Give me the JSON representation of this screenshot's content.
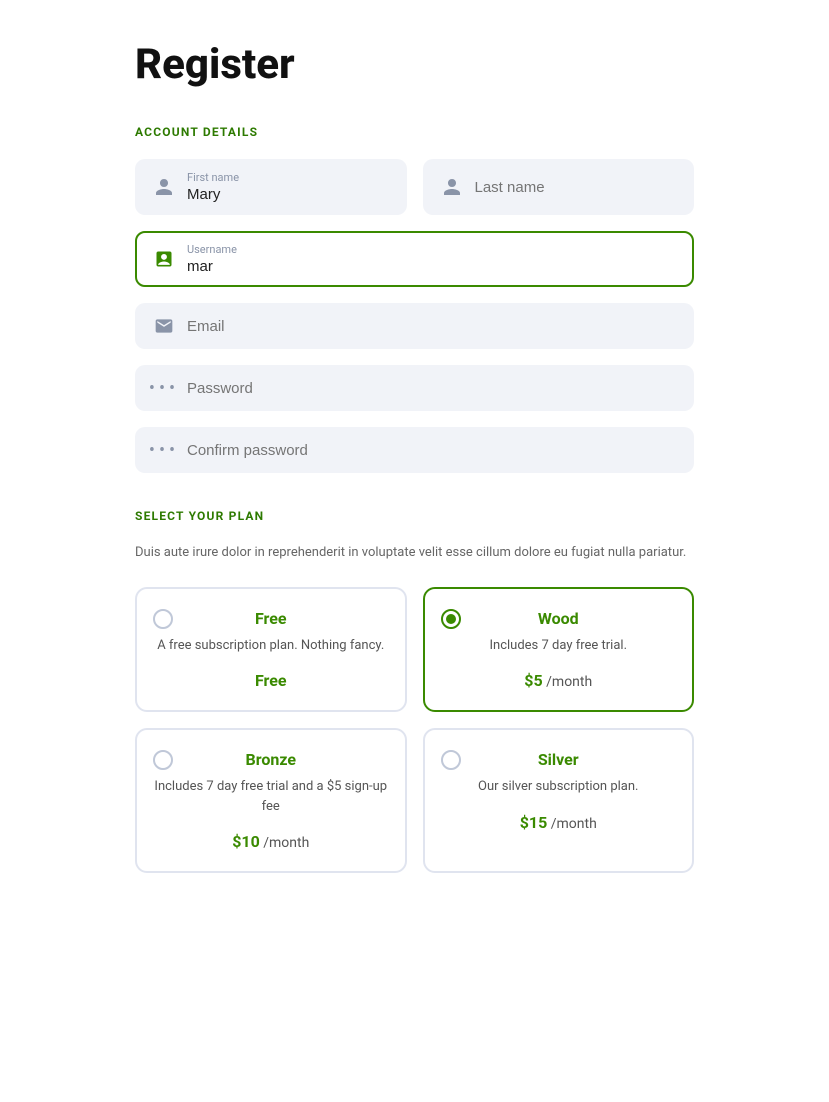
{
  "page": {
    "title": "Register"
  },
  "account_section": {
    "label": "ACCOUNT DETAILS",
    "first_name": {
      "label": "First name",
      "value": "Mary",
      "placeholder": ""
    },
    "last_name": {
      "label": "Last name",
      "value": "",
      "placeholder": "Last name"
    },
    "username": {
      "label": "Username",
      "value": "mar",
      "placeholder": ""
    },
    "email": {
      "label": "Email",
      "placeholder": "Email"
    },
    "password": {
      "label": "Password",
      "placeholder": "Password"
    },
    "confirm_password": {
      "label": "Confirm password",
      "placeholder": "Confirm password"
    }
  },
  "plan_section": {
    "label": "SELECT YOUR PLAN",
    "description": "Duis aute irure dolor in reprehenderit in voluptate velit esse cillum dolore eu fugiat nulla pariatur.",
    "plans": [
      {
        "id": "free",
        "name": "Free",
        "description": "A free subscription plan. Nothing fancy.",
        "price": "Free",
        "price_suffix": "",
        "selected": false
      },
      {
        "id": "wood",
        "name": "Wood",
        "description": "Includes 7 day free trial.",
        "price": "$5",
        "price_suffix": "/month",
        "selected": true
      },
      {
        "id": "bronze",
        "name": "Bronze",
        "description": "Includes 7 day free trial and a $5 sign-up fee",
        "price": "$10",
        "price_suffix": "/month",
        "selected": false
      },
      {
        "id": "silver",
        "name": "Silver",
        "description": "Our silver subscription plan.",
        "price": "$15",
        "price_suffix": "/month",
        "selected": false
      }
    ]
  }
}
